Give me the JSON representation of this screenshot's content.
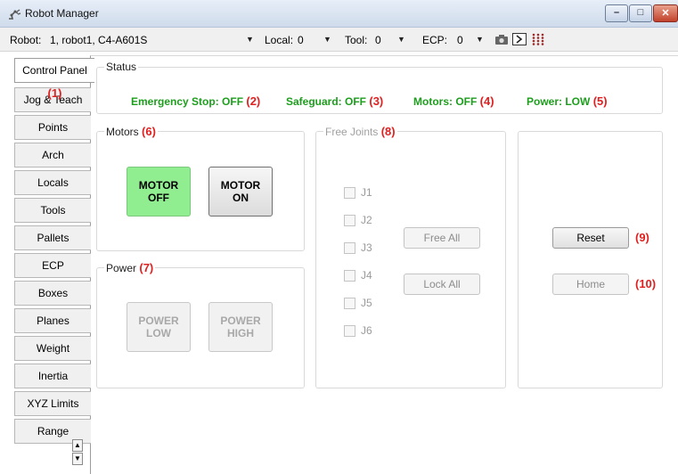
{
  "window": {
    "title": "Robot Manager",
    "controls": {
      "minimize": "–",
      "maximize": "□",
      "close": "✕"
    }
  },
  "toolbar": {
    "robot_label": "Robot:",
    "robot_value": "1, robot1, C4-A601S",
    "local_label": "Local:",
    "local_value": "0",
    "tool_label": "Tool:",
    "tool_value": "0",
    "ecp_label": "ECP:",
    "ecp_value": "0",
    "icons": [
      "camera-icon",
      "terminal-icon",
      "io-grid-icon"
    ]
  },
  "tabs": [
    {
      "label": "Control Panel",
      "active": true,
      "anno": "(1)"
    },
    {
      "label": "Jog & Teach"
    },
    {
      "label": "Points"
    },
    {
      "label": "Arch"
    },
    {
      "label": "Locals"
    },
    {
      "label": "Tools"
    },
    {
      "label": "Pallets"
    },
    {
      "label": "ECP"
    },
    {
      "label": "Boxes"
    },
    {
      "label": "Planes"
    },
    {
      "label": "Weight"
    },
    {
      "label": "Inertia"
    },
    {
      "label": "XYZ Limits"
    },
    {
      "label": "Range"
    }
  ],
  "status": {
    "title": "Status",
    "emergency_stop": "Emergency Stop: OFF",
    "emergency_anno": "(2)",
    "safeguard": "Safeguard: OFF",
    "safeguard_anno": "(3)",
    "motors": "Motors: OFF",
    "motors_anno": "(4)",
    "power": "Power: LOW",
    "power_anno": "(5)",
    "color": "#1d9e1d"
  },
  "motors": {
    "title": "Motors",
    "anno": "(6)",
    "off_label": "MOTOR\nOFF",
    "on_label": "MOTOR\nON",
    "active_color": "#90ee90"
  },
  "power": {
    "title": "Power",
    "anno": "(7)",
    "low_label": "POWER\nLOW",
    "high_label": "POWER\nHIGH"
  },
  "free_joints": {
    "title": "Free Joints",
    "anno": "(8)",
    "joints": [
      "J1",
      "J2",
      "J3",
      "J4",
      "J5",
      "J6"
    ],
    "free_all": "Free All",
    "lock_all": "Lock All"
  },
  "actions": {
    "reset": "Reset",
    "reset_anno": "(9)",
    "home": "Home",
    "home_anno": "(10)"
  },
  "annotation_color": "#e02020"
}
